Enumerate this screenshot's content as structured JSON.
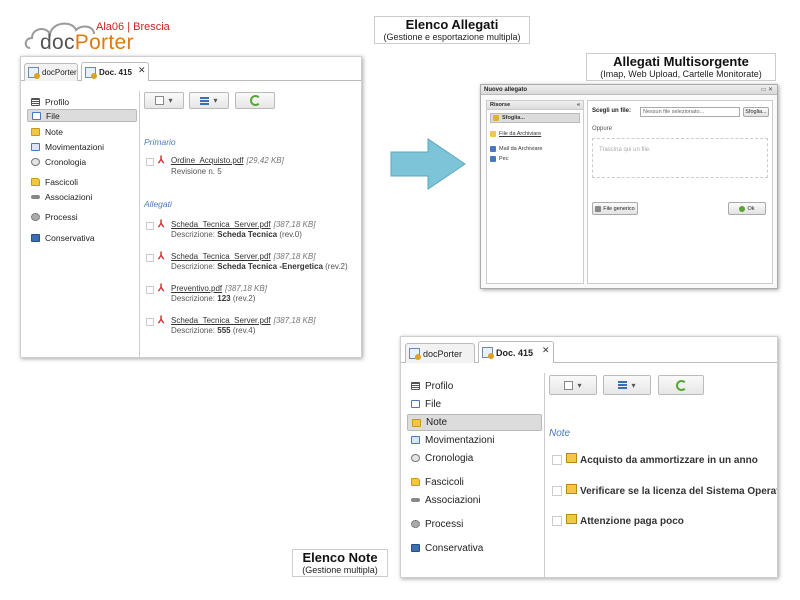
{
  "logo": {
    "subtitle": "Ala06 | Brescia",
    "name_part1": "doc",
    "name_part2": "Porter"
  },
  "captions": {
    "elenco_allegati": {
      "title": "Elenco Allegati",
      "subtitle": "(Gestione e esportazione multipla)"
    },
    "allegati_multisorgente": {
      "title": "Allegati Multisorgente",
      "subtitle": "(Imap, Web Upload, Cartelle Monitorate)"
    },
    "elenco_note": {
      "title": "Elenco Note",
      "subtitle": "(Gestione multipla)"
    }
  },
  "tabs": [
    {
      "label": "docPorter"
    },
    {
      "label": "Doc. 415"
    }
  ],
  "close_glyph": "✕",
  "menu": [
    {
      "label": "Profilo",
      "icon": "profilo-icon"
    },
    {
      "label": "File",
      "icon": "file-icon"
    },
    {
      "label": "Note",
      "icon": "note-icon"
    },
    {
      "label": "Movimentazioni",
      "icon": "movimentazioni-icon"
    },
    {
      "label": "Cronologia",
      "icon": "cronologia-icon"
    },
    {
      "label": "Fascicoli",
      "icon": "fascicoli-icon"
    },
    {
      "label": "Associazioni",
      "icon": "associazioni-icon"
    },
    {
      "label": "Processi",
      "icon": "processi-icon"
    },
    {
      "label": "Conservativa",
      "icon": "conservativa-icon"
    }
  ],
  "dropdown_glyph": "▾",
  "attachments": {
    "primary_heading": "Primario",
    "primary": [
      {
        "name": "Ordine_Acquisto.pdf",
        "size": "[29,42 KB]",
        "desc_label": "Revisione n. ",
        "desc_value": "5",
        "desc_suffix": ""
      }
    ],
    "attached_heading": "Allegati",
    "attached": [
      {
        "name": "Scheda_Tecnica_Server.pdf",
        "size": "[387,18 KB]",
        "desc_label": "Descrizione: ",
        "desc_value": "Scheda Tecnica",
        "desc_suffix": " (rev.0)"
      },
      {
        "name": "Scheda_Tecnica_Server.pdf",
        "size": "[387,18 KB]",
        "desc_label": "Descrizione: ",
        "desc_value": "Scheda Tecnica -Energetica",
        "desc_suffix": " (rev.2)"
      },
      {
        "name": "Preventivo.pdf",
        "size": "[387,18 KB]",
        "desc_label": "Descrizione: ",
        "desc_value": "123",
        "desc_suffix": " (rev.2)"
      },
      {
        "name": "Scheda_Tecnica_Server.pdf",
        "size": "[387,18 KB]",
        "desc_label": "Descrizione: ",
        "desc_value": "555",
        "desc_suffix": " (rev.4)"
      }
    ]
  },
  "dialog": {
    "title": "Nuovo allegato",
    "controls": "▭ ✕",
    "resources_heading": "Risorse",
    "resources_collapse": "«",
    "resources": [
      {
        "label": "Sfoglia...",
        "selected": true
      },
      {
        "label": "File da Archiviare",
        "selected": false
      },
      {
        "label": "Mail da Archiviare",
        "selected": false
      },
      {
        "label": "Pec",
        "selected": false
      }
    ],
    "choose_label": "Scegli un file:",
    "file_placeholder": "Nessun file selezionato...",
    "browse_button": "Sfoglia...",
    "or_label": "Oppure",
    "drop_hint": "Trascina qui un file.",
    "generic_file_button": "File generico",
    "ok_button": "Ok"
  },
  "notes": {
    "heading": "Note",
    "items": [
      {
        "text": "Acquisto da ammortizzare in un anno"
      },
      {
        "text": "Verificare se la licenza del Sistema Operativo è"
      },
      {
        "text": "Attenzione paga poco"
      }
    ]
  },
  "colors": {
    "accent_blue": "#4a78c0",
    "logo_orange": "#e07a10",
    "logo_red": "#cc2222",
    "arrow": "#7ec4d8"
  }
}
